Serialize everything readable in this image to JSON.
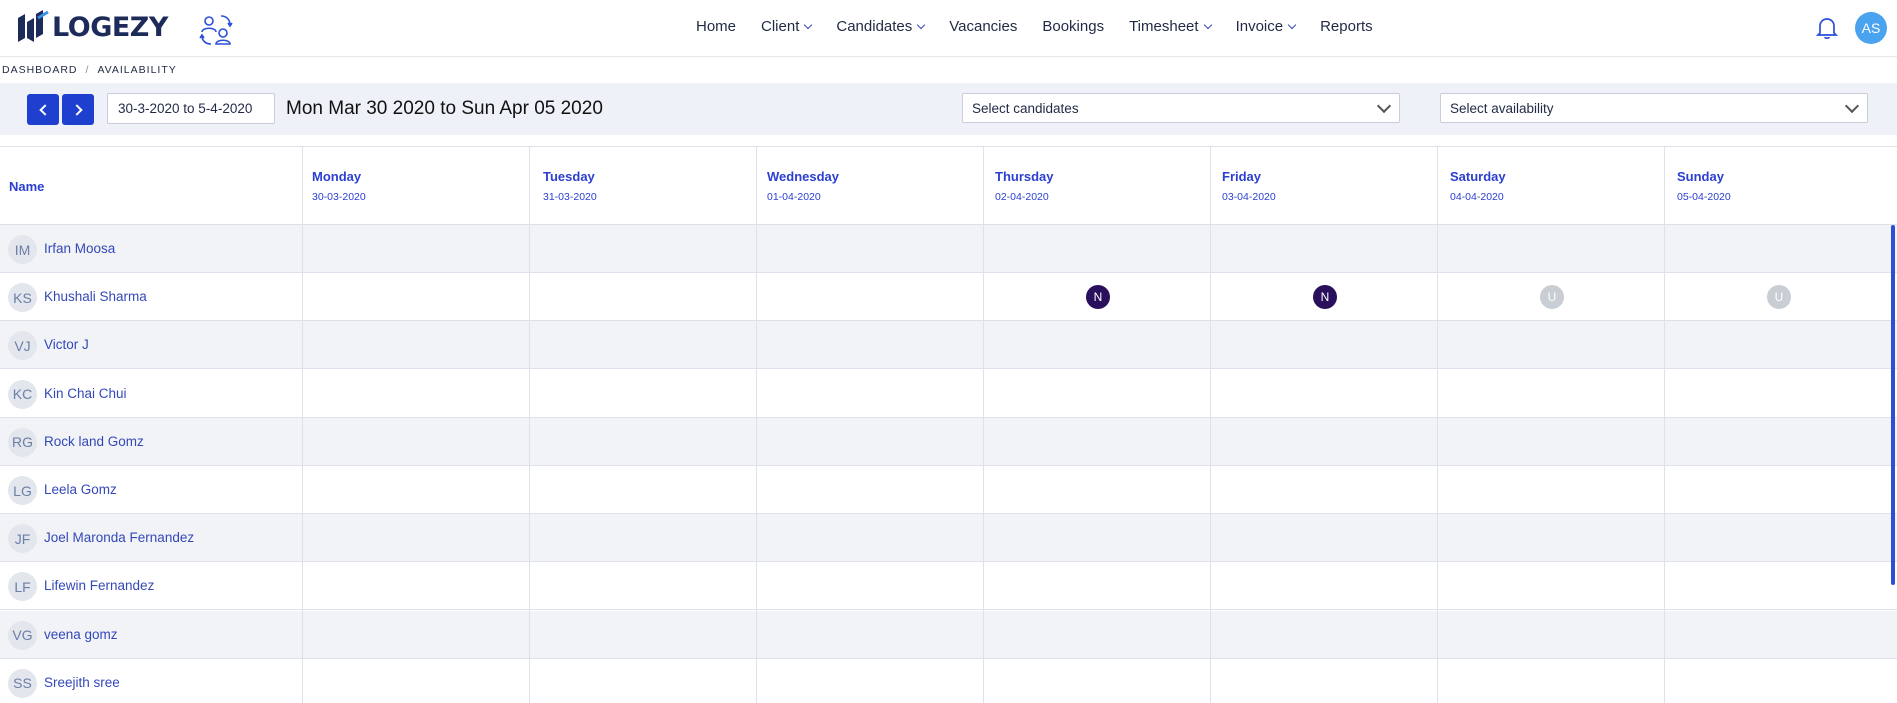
{
  "brand": {
    "name": "LOGEZY",
    "color": "#1c2b5a",
    "accent": "#1f3fcf"
  },
  "nav": {
    "items": [
      {
        "label": "Home",
        "dropdown": false
      },
      {
        "label": "Client",
        "dropdown": true
      },
      {
        "label": "Candidates",
        "dropdown": true
      },
      {
        "label": "Vacancies",
        "dropdown": false
      },
      {
        "label": "Bookings",
        "dropdown": false
      },
      {
        "label": "Timesheet",
        "dropdown": true
      },
      {
        "label": "Invoice",
        "dropdown": true
      },
      {
        "label": "Reports",
        "dropdown": false
      }
    ],
    "user_initials": "AS",
    "icons": [
      "swap-users-icon",
      "bell-icon"
    ]
  },
  "breadcrumb": {
    "root": "DASHBOARD",
    "current": "AVAILABILITY"
  },
  "toolbar": {
    "date_range_value": "30-3-2020 to 5-4-2020",
    "range_title": "Mon Mar 30 2020 to Sun Apr 05 2020",
    "candidates_select": "Select candidates",
    "availability_select": "Select availability"
  },
  "grid": {
    "name_header": "Name",
    "days": [
      {
        "name": "Monday",
        "date": "30-03-2020"
      },
      {
        "name": "Tuesday",
        "date": "31-03-2020"
      },
      {
        "name": "Wednesday",
        "date": "01-04-2020"
      },
      {
        "name": "Thursday",
        "date": "02-04-2020"
      },
      {
        "name": "Friday",
        "date": "03-04-2020"
      },
      {
        "name": "Saturday",
        "date": "04-04-2020"
      },
      {
        "name": "Sunday",
        "date": "05-04-2020"
      }
    ],
    "candidates": [
      {
        "initials": "IM",
        "name": "Irfan Moosa",
        "availability": [
          "",
          "",
          "",
          "",
          "",
          "",
          ""
        ]
      },
      {
        "initials": "KS",
        "name": "Khushali Sharma",
        "availability": [
          "",
          "",
          "",
          "N",
          "N",
          "U",
          "U"
        ]
      },
      {
        "initials": "VJ",
        "name": "Victor J",
        "availability": [
          "",
          "",
          "",
          "",
          "",
          "",
          ""
        ]
      },
      {
        "initials": "KC",
        "name": "Kin Chai Chui",
        "availability": [
          "",
          "",
          "",
          "",
          "",
          "",
          ""
        ]
      },
      {
        "initials": "RG",
        "name": "Rock land Gomz",
        "availability": [
          "",
          "",
          "",
          "",
          "",
          "",
          ""
        ]
      },
      {
        "initials": "LG",
        "name": "Leela Gomz",
        "availability": [
          "",
          "",
          "",
          "",
          "",
          "",
          ""
        ]
      },
      {
        "initials": "JF",
        "name": "Joel Maronda Fernandez",
        "availability": [
          "",
          "",
          "",
          "",
          "",
          "",
          ""
        ]
      },
      {
        "initials": "LF",
        "name": "Lifewin Fernandez",
        "availability": [
          "",
          "",
          "",
          "",
          "",
          "",
          ""
        ]
      },
      {
        "initials": "VG",
        "name": "veena gomz",
        "availability": [
          "",
          "",
          "",
          "",
          "",
          "",
          ""
        ]
      },
      {
        "initials": "SS",
        "name": "Sreejith sree",
        "availability": [
          "",
          "",
          "",
          "",
          "",
          "",
          ""
        ]
      }
    ],
    "status_colors": {
      "N": "#2a0f5c",
      "U": "#c9cdd4"
    }
  }
}
